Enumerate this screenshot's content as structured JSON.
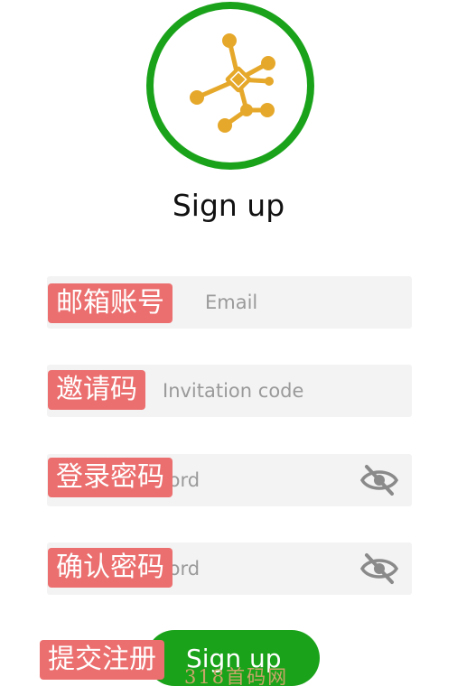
{
  "logo": {
    "icon": "network-nodes-icon",
    "ring_color": "#1aa31a",
    "icon_color": "#e6a82a"
  },
  "header": {
    "title": "Sign up"
  },
  "form": {
    "email": {
      "placeholder": "Email",
      "annotation": "邮箱账号"
    },
    "invite": {
      "placeholder": "Invitation code",
      "annotation": "邀请码"
    },
    "password": {
      "placeholder": "Password",
      "annotation": "登录密码",
      "toggle_icon": "eye-off-icon"
    },
    "confirm": {
      "placeholder": "Password",
      "annotation": "确认密码",
      "toggle_icon": "eye-off-icon"
    },
    "submit": {
      "label": "Sign up",
      "annotation": "提交注册",
      "color": "#1aa31a"
    }
  },
  "annotation_color": "#ec6f6f",
  "watermark": {
    "text": "318首码网"
  }
}
